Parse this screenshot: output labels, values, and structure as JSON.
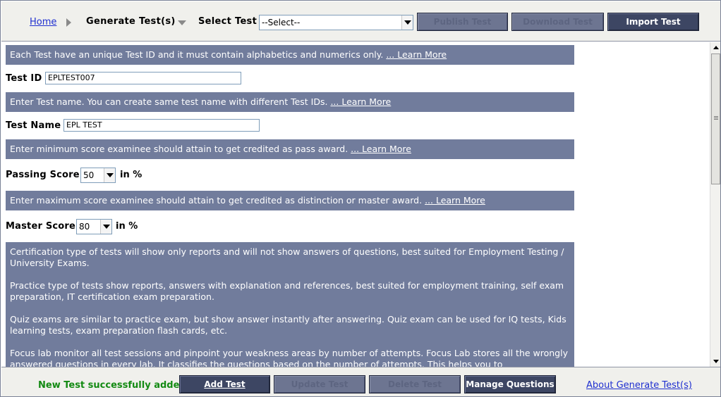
{
  "toolbar": {
    "home_link": "Home",
    "section_title": "Generate Test(s)",
    "select_label": "Select Test",
    "select_value": "--Select--",
    "publish_label": "Publish Test",
    "download_label": "Download Test",
    "import_label": "Import Test"
  },
  "content": {
    "info_test_id": "Each Test have an unique Test ID and it must contain alphabetics and numerics only.",
    "info_test_name": "Enter Test name. You can create same test name with different Test IDs.",
    "info_passing": "Enter minimum score examinee should attain to get credited as pass award.",
    "info_master": "Enter maximum score examinee should attain to get credited as distinction or master award.",
    "learn_more": "... Learn More",
    "test_id_label": "Test ID",
    "test_id_value": "EPLTEST007",
    "test_name_label": "Test Name",
    "test_name_value": "EPL TEST",
    "passing_label": "Passing Score",
    "passing_value": "50",
    "master_label": "Master Score",
    "master_value": "80",
    "unit": "in %",
    "type_paragraphs": [
      "Certification type of tests will show only reports and will not show answers of questions, best suited for Employment Testing / University Exams.",
      "Practice type of tests show reports, answers with explanation and references, best suited for employment training, self exam preparation, IT certification exam preparation.",
      "Quiz exams are similar to practice exam, but show answer instantly after answering. Quiz exam can be used for IQ tests, Kids learning tests, exam preparation flash cards, etc.",
      "Focus lab monitor all test sessions and pinpoint your weakness areas by number of attempts. Focus Lab stores all the wrongly answered questions in every lab. It classifies the questions based on the number of attempts. This helps you to"
    ]
  },
  "footer": {
    "status_message": "New Test successfully added.",
    "add_test_label": "Add Test",
    "update_test_label": "Update Test",
    "delete_test_label": "Delete Test",
    "manage_questions_label": "Manage Questions",
    "about_link": "About Generate Test(s)"
  },
  "colors": {
    "info_bg": "#717c9c",
    "button_bg": "#3d4663",
    "status_green": "#138a13",
    "link_blue": "#1f2fd0"
  }
}
